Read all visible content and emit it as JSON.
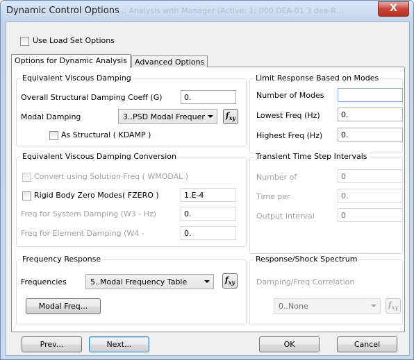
{
  "window": {
    "title": "Dynamic Control Options",
    "ghost_title": "… Analysis with Manager (Active: 1; 000 DEA-01 3 dea-R…",
    "close_label": "X"
  },
  "top": {
    "use_load_set_label": "Use Load Set Options",
    "use_load_set_checked": false
  },
  "tabs": [
    {
      "label": "Options for Dynamic Analysis",
      "active": true
    },
    {
      "label": "Advanced Options",
      "active": false
    }
  ],
  "eq_damping": {
    "title": "Equivalent Viscous Damping",
    "overall_label": "Overall Structural Damping Coeff (G)",
    "overall_value": "0.",
    "modal_label": "Modal Damping",
    "modal_value": "3..PSD Modal Frequer",
    "as_structural_label": "As Structural ( KDAMP )",
    "as_structural_checked": false
  },
  "limit_modes": {
    "title": "Limit Response Based on Modes",
    "num_modes_label": "Number of Modes",
    "num_modes_value": "",
    "lowest_label": "Lowest Freq (Hz)",
    "lowest_value": "0.",
    "highest_label": "Highest Freq (Hz)",
    "highest_value": "0."
  },
  "conversion": {
    "title": "Equivalent Viscous Damping Conversion",
    "convert_label": "Convert using Solution Freq ( WMODAL )",
    "rigid_label": "Rigid Body Zero Modes( FZERO )",
    "rigid_value": "1.E-4",
    "w3_label": "Freq for System Damping (W3 - Hz)",
    "w3_value": "0.",
    "w4_label": "Freq for Element Damping (W4 -",
    "w4_value": "0."
  },
  "transient": {
    "title": "Transient Time Step Intervals",
    "number_label": "Number of",
    "number_value": "0",
    "time_label": "Time per",
    "time_value": "0.",
    "output_label": "Output Interval",
    "output_value": "0"
  },
  "freq_response": {
    "title": "Frequency Response",
    "freq_label": "Frequencies",
    "freq_value": "5..Modal Frequency Table",
    "modal_freq_button": "Modal Freq..."
  },
  "shock": {
    "title": "Response/Shock Spectrum",
    "correlation_label": "Damping/Freq Correlation",
    "correlation_value": "0..None"
  },
  "footer": {
    "prev_label": "Prev...",
    "next_label": "Next...",
    "ok_label": "OK",
    "cancel_label": "Cancel"
  },
  "fx_symbol": "f",
  "fx_sub": "xy"
}
